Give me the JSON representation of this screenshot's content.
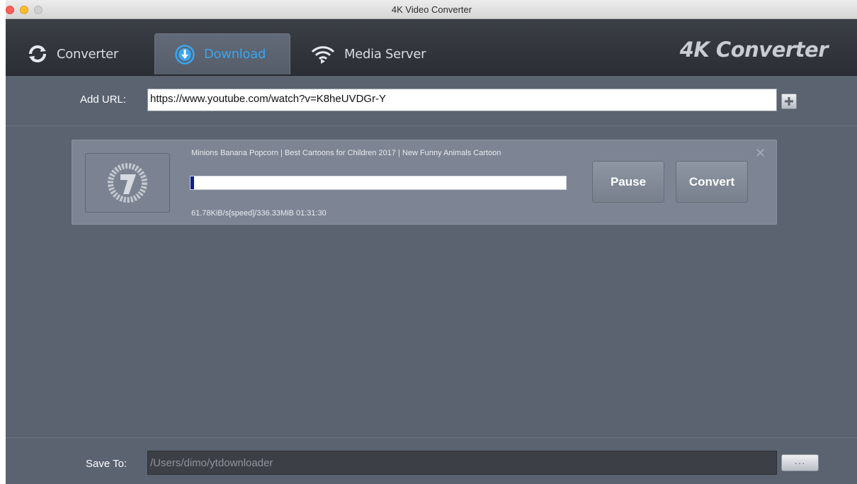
{
  "window": {
    "title": "4K Video Converter"
  },
  "tabs": [
    {
      "label": "Converter",
      "icon": "refresh-icon",
      "active": false
    },
    {
      "label": "Download",
      "icon": "download-icon",
      "active": true
    },
    {
      "label": "Media Server",
      "icon": "wifi-icon",
      "active": false
    }
  ],
  "brand": "4K Converter",
  "url_row": {
    "label": "Add URL:",
    "value": "https://www.youtube.com/watch?v=K8heUVDGr-Y",
    "add_icon": "plus-icon"
  },
  "download_item": {
    "title": "Minions Banana Popcorn | Best Cartoons for Children 2017 | New Funny Animals Cartoon",
    "status": "61.78KiB/s[speed]/336.33MiB 01:31:30",
    "progress_fraction": 0.01,
    "thumbnail_icon": "placeholder-video-icon",
    "pause_label": "Pause",
    "convert_label": "Convert",
    "close_icon": "close-icon"
  },
  "save_row": {
    "label": "Save To:",
    "value": "/Users/dimo/ytdownloader",
    "browse_label": "···"
  },
  "colors": {
    "accent_tab_text": "#3aa6ef",
    "progress_fill": "#10208c",
    "background": "#5b6270"
  }
}
